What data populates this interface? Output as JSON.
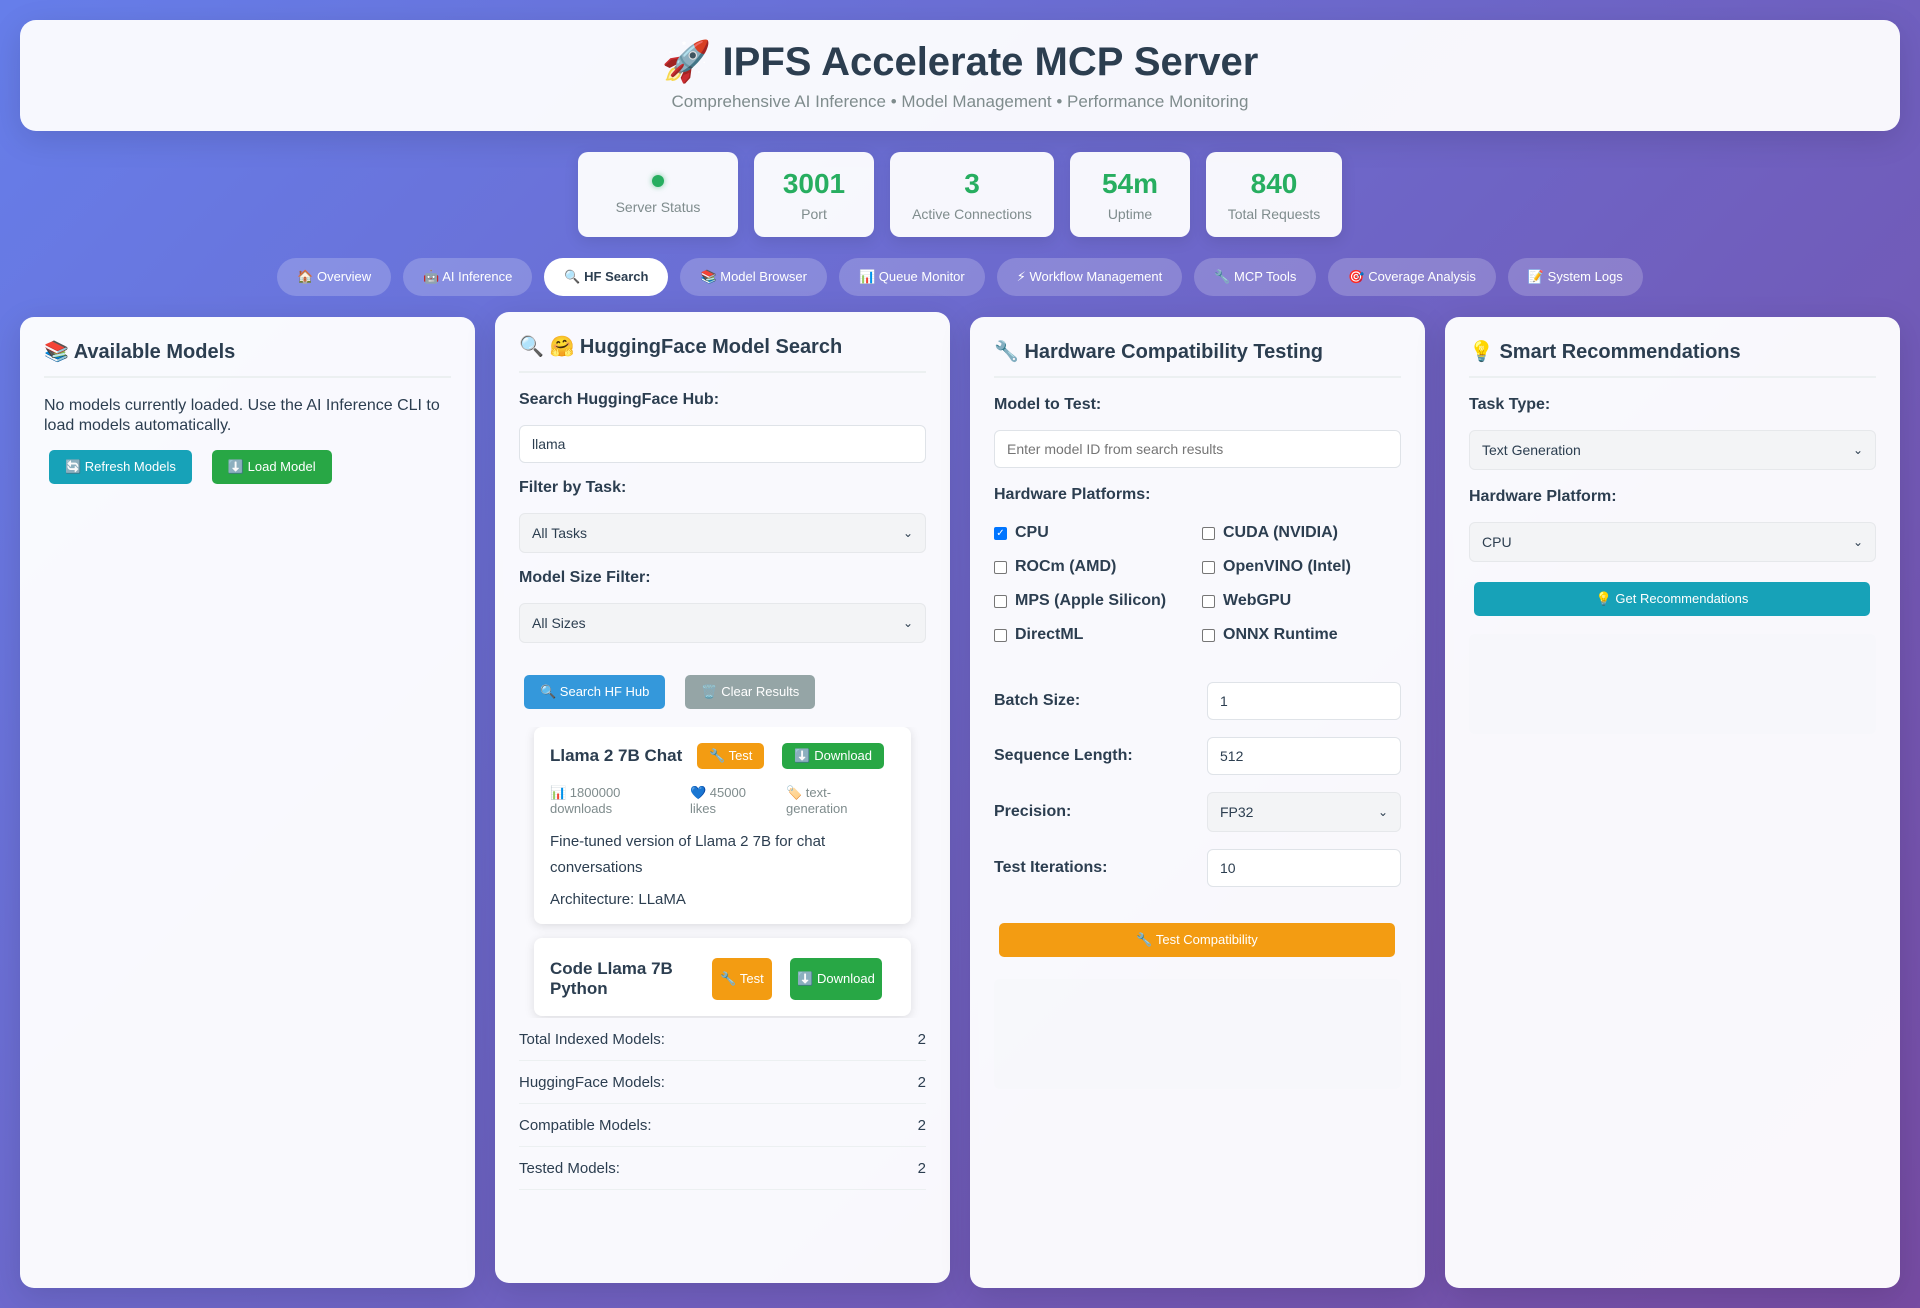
{
  "header": {
    "title": "🚀 IPFS Accelerate MCP Server",
    "subtitle": "Comprehensive AI Inference • Model Management • Performance Monitoring"
  },
  "stats": {
    "server_status_label": "Server Status",
    "port_value": "3001",
    "port_label": "Port",
    "connections_value": "3",
    "connections_label": "Active Connections",
    "uptime_value": "54m",
    "uptime_label": "Uptime",
    "requests_value": "840",
    "requests_label": "Total Requests"
  },
  "tabs": [
    {
      "label": "🏠 Overview"
    },
    {
      "label": "🤖 AI Inference"
    },
    {
      "label": "🔍 HF Search"
    },
    {
      "label": "📚 Model Browser"
    },
    {
      "label": "📊 Queue Monitor"
    },
    {
      "label": "⚡ Workflow Management"
    },
    {
      "label": "🔧 MCP Tools"
    },
    {
      "label": "🎯 Coverage Analysis"
    },
    {
      "label": "📝 System Logs"
    }
  ],
  "models_panel": {
    "title": "📚 Available Models",
    "empty_text": "No models currently loaded. Use the AI Inference CLI to load models automatically.",
    "refresh_label": "🔄 Refresh Models",
    "load_label": "⬇️ Load Model"
  },
  "hf_panel": {
    "title": "🔍 🤗 HuggingFace Model Search",
    "search_label": "Search HuggingFace Hub:",
    "search_value": "llama",
    "task_label": "Filter by Task:",
    "task_value": "All Tasks",
    "size_label": "Model Size Filter:",
    "size_value": "All Sizes",
    "search_button": "🔍 Search HF Hub",
    "clear_button": "🗑️ Clear Results",
    "results": [
      {
        "name": "Llama 2 7B Chat",
        "test_label": "🔧 Test",
        "download_label": "⬇️ Download",
        "downloads": "📊 1800000 downloads",
        "likes": "💙 45000 likes",
        "task": "🏷️ text-generation",
        "description": "Fine-tuned version of Llama 2 7B for chat conversations",
        "architecture": "Architecture: LLaMA"
      },
      {
        "name": "Code Llama 7B Python",
        "test_label": "🔧 Test",
        "download_label": "⬇️ Download"
      }
    ],
    "summary": [
      {
        "label": "Total Indexed Models:",
        "value": "2"
      },
      {
        "label": "HuggingFace Models:",
        "value": "2"
      },
      {
        "label": "Compatible Models:",
        "value": "2"
      },
      {
        "label": "Tested Models:",
        "value": "2"
      }
    ]
  },
  "hw_panel": {
    "title": "🔧 Hardware Compatibility Testing",
    "model_label": "Model to Test:",
    "model_placeholder": "Enter model ID from search results",
    "platforms_label": "Hardware Platforms:",
    "platforms": [
      {
        "label": "CPU",
        "checked": true
      },
      {
        "label": "CUDA (NVIDIA)",
        "checked": false
      },
      {
        "label": "ROCm (AMD)",
        "checked": false
      },
      {
        "label": "OpenVINO (Intel)",
        "checked": false
      },
      {
        "label": "MPS (Apple Silicon)",
        "checked": false
      },
      {
        "label": "WebGPU",
        "checked": false
      },
      {
        "label": "DirectML",
        "checked": false
      },
      {
        "label": "ONNX Runtime",
        "checked": false
      }
    ],
    "batch_label": "Batch Size:",
    "batch_value": "1",
    "seq_label": "Sequence Length:",
    "seq_value": "512",
    "precision_label": "Precision:",
    "precision_value": "FP32",
    "iter_label": "Test Iterations:",
    "iter_value": "10",
    "test_button": "🔧 Test Compatibility"
  },
  "rec_panel": {
    "title": "💡 Smart Recommendations",
    "task_label": "Task Type:",
    "task_value": "Text Generation",
    "platform_label": "Hardware Platform:",
    "platform_value": "CPU",
    "button": "💡 Get Recommendations"
  },
  "colors": {
    "bg_start": "#667eea",
    "bg_end": "#764ba2",
    "stat_green": "#27ae60",
    "teal": "#17a2b8",
    "green": "#28a745",
    "blue": "#3498db",
    "orange": "#f39c12",
    "gray": "#95a5a6"
  }
}
